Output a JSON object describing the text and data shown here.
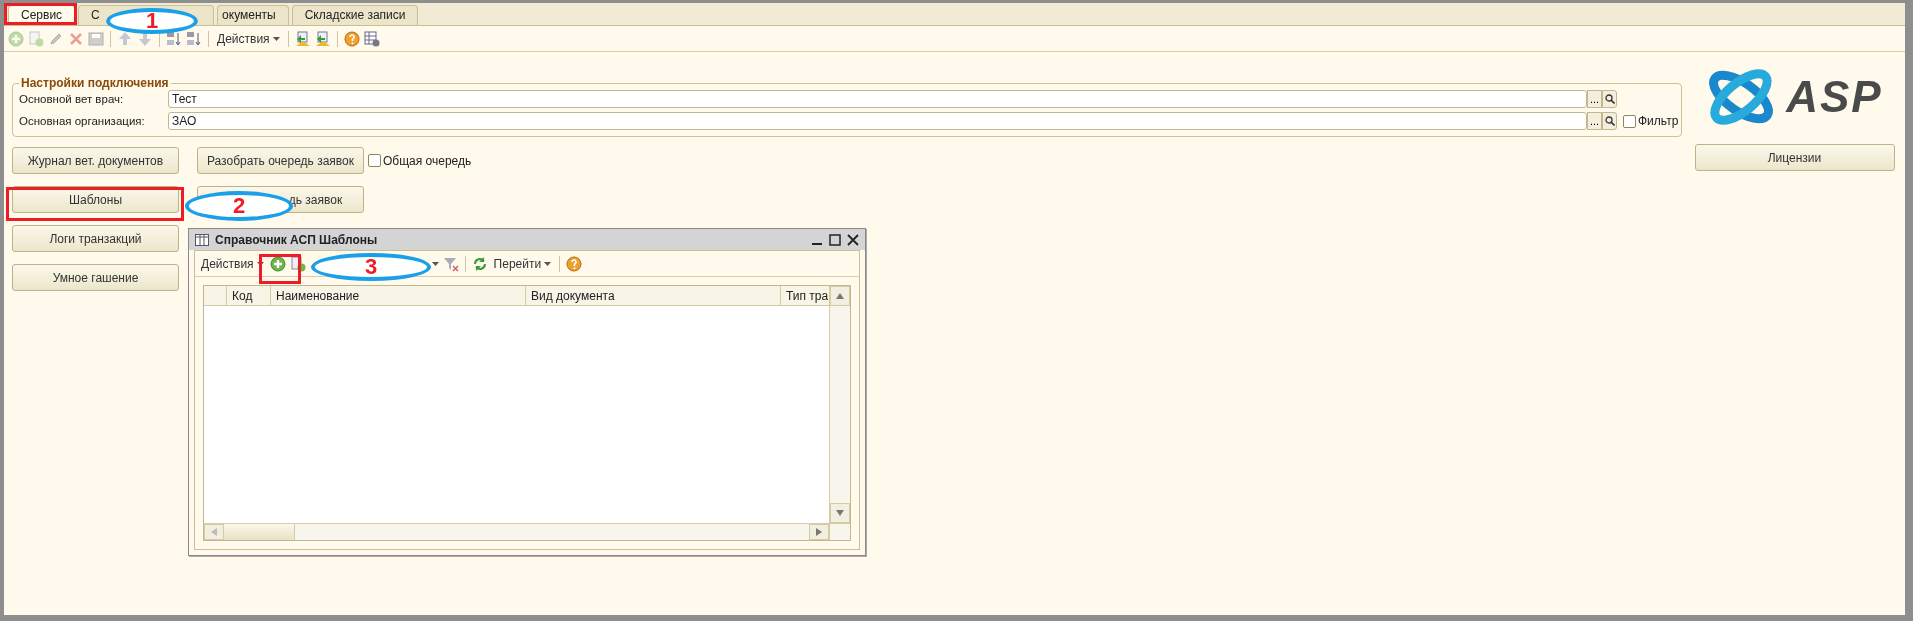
{
  "tabs": [
    {
      "label": "Сервис",
      "selected": true
    },
    {
      "label": "С",
      "selected": false
    },
    {
      "label": "окументы",
      "selected": false
    },
    {
      "label": "Складские записи",
      "selected": false
    }
  ],
  "toolbar": {
    "items": [
      {
        "kind": "add",
        "disabled": true
      },
      {
        "kind": "copy",
        "disabled": true
      },
      {
        "kind": "edit",
        "disabled": true
      },
      {
        "kind": "delete",
        "disabled": true
      },
      {
        "kind": "save",
        "disabled": true
      },
      {
        "kind": "separator"
      },
      {
        "kind": "up",
        "disabled": true
      },
      {
        "kind": "down",
        "disabled": true
      },
      {
        "kind": "separator"
      },
      {
        "kind": "sort-asc",
        "disabled": false
      },
      {
        "kind": "sort-desc",
        "disabled": false
      },
      {
        "kind": "separator"
      },
      {
        "kind": "menu",
        "label": "Действия"
      },
      {
        "kind": "separator"
      },
      {
        "kind": "import",
        "disabled": false
      },
      {
        "kind": "export",
        "disabled": false
      },
      {
        "kind": "separator"
      },
      {
        "kind": "help",
        "disabled": false
      },
      {
        "kind": "table-settings",
        "disabled": false
      }
    ]
  },
  "settings": {
    "title": "Настройки подключения",
    "fields": [
      {
        "label": "Основной вет врач:",
        "value": "Тест",
        "choose": "..."
      },
      {
        "label": "Основная организация:",
        "value": "ЗАО",
        "choose": "...",
        "filter": {
          "label": "Фильтр",
          "checked": false
        }
      }
    ]
  },
  "logo": {
    "text": "ASP"
  },
  "left_buttons": [
    "Журнал вет. документов",
    "Шаблоны",
    "Логи транзакций",
    "Умное гашение"
  ],
  "middle": {
    "buttons": [
      "Разобрать очередь заявок",
      "дь заявок"
    ],
    "checkbox": {
      "label": "Общая очередь",
      "checked": false
    }
  },
  "licenses_button": "Лицензии",
  "dialog": {
    "title": "Справочник АСП Шаблоны",
    "toolbar": {
      "items": [
        {
          "kind": "menu",
          "label": "Действия"
        },
        {
          "kind": "add"
        },
        {
          "kind": "copy"
        },
        {
          "kind": "gap"
        },
        {
          "kind": "caret"
        },
        {
          "kind": "filter-clear"
        },
        {
          "kind": "separator"
        },
        {
          "kind": "refresh"
        },
        {
          "kind": "menu",
          "label": "Перейти"
        },
        {
          "kind": "separator"
        },
        {
          "kind": "help"
        }
      ]
    },
    "table": {
      "columns": [
        "Код",
        "Наименование",
        "Вид документа",
        "Тип тра"
      ]
    }
  },
  "annotations": [
    {
      "kind": "box"
    },
    {
      "kind": "ellipse",
      "number": "1"
    },
    {
      "kind": "box"
    },
    {
      "kind": "ellipse",
      "number": "2"
    },
    {
      "kind": "box"
    },
    {
      "kind": "ellipse",
      "number": "3"
    }
  ]
}
